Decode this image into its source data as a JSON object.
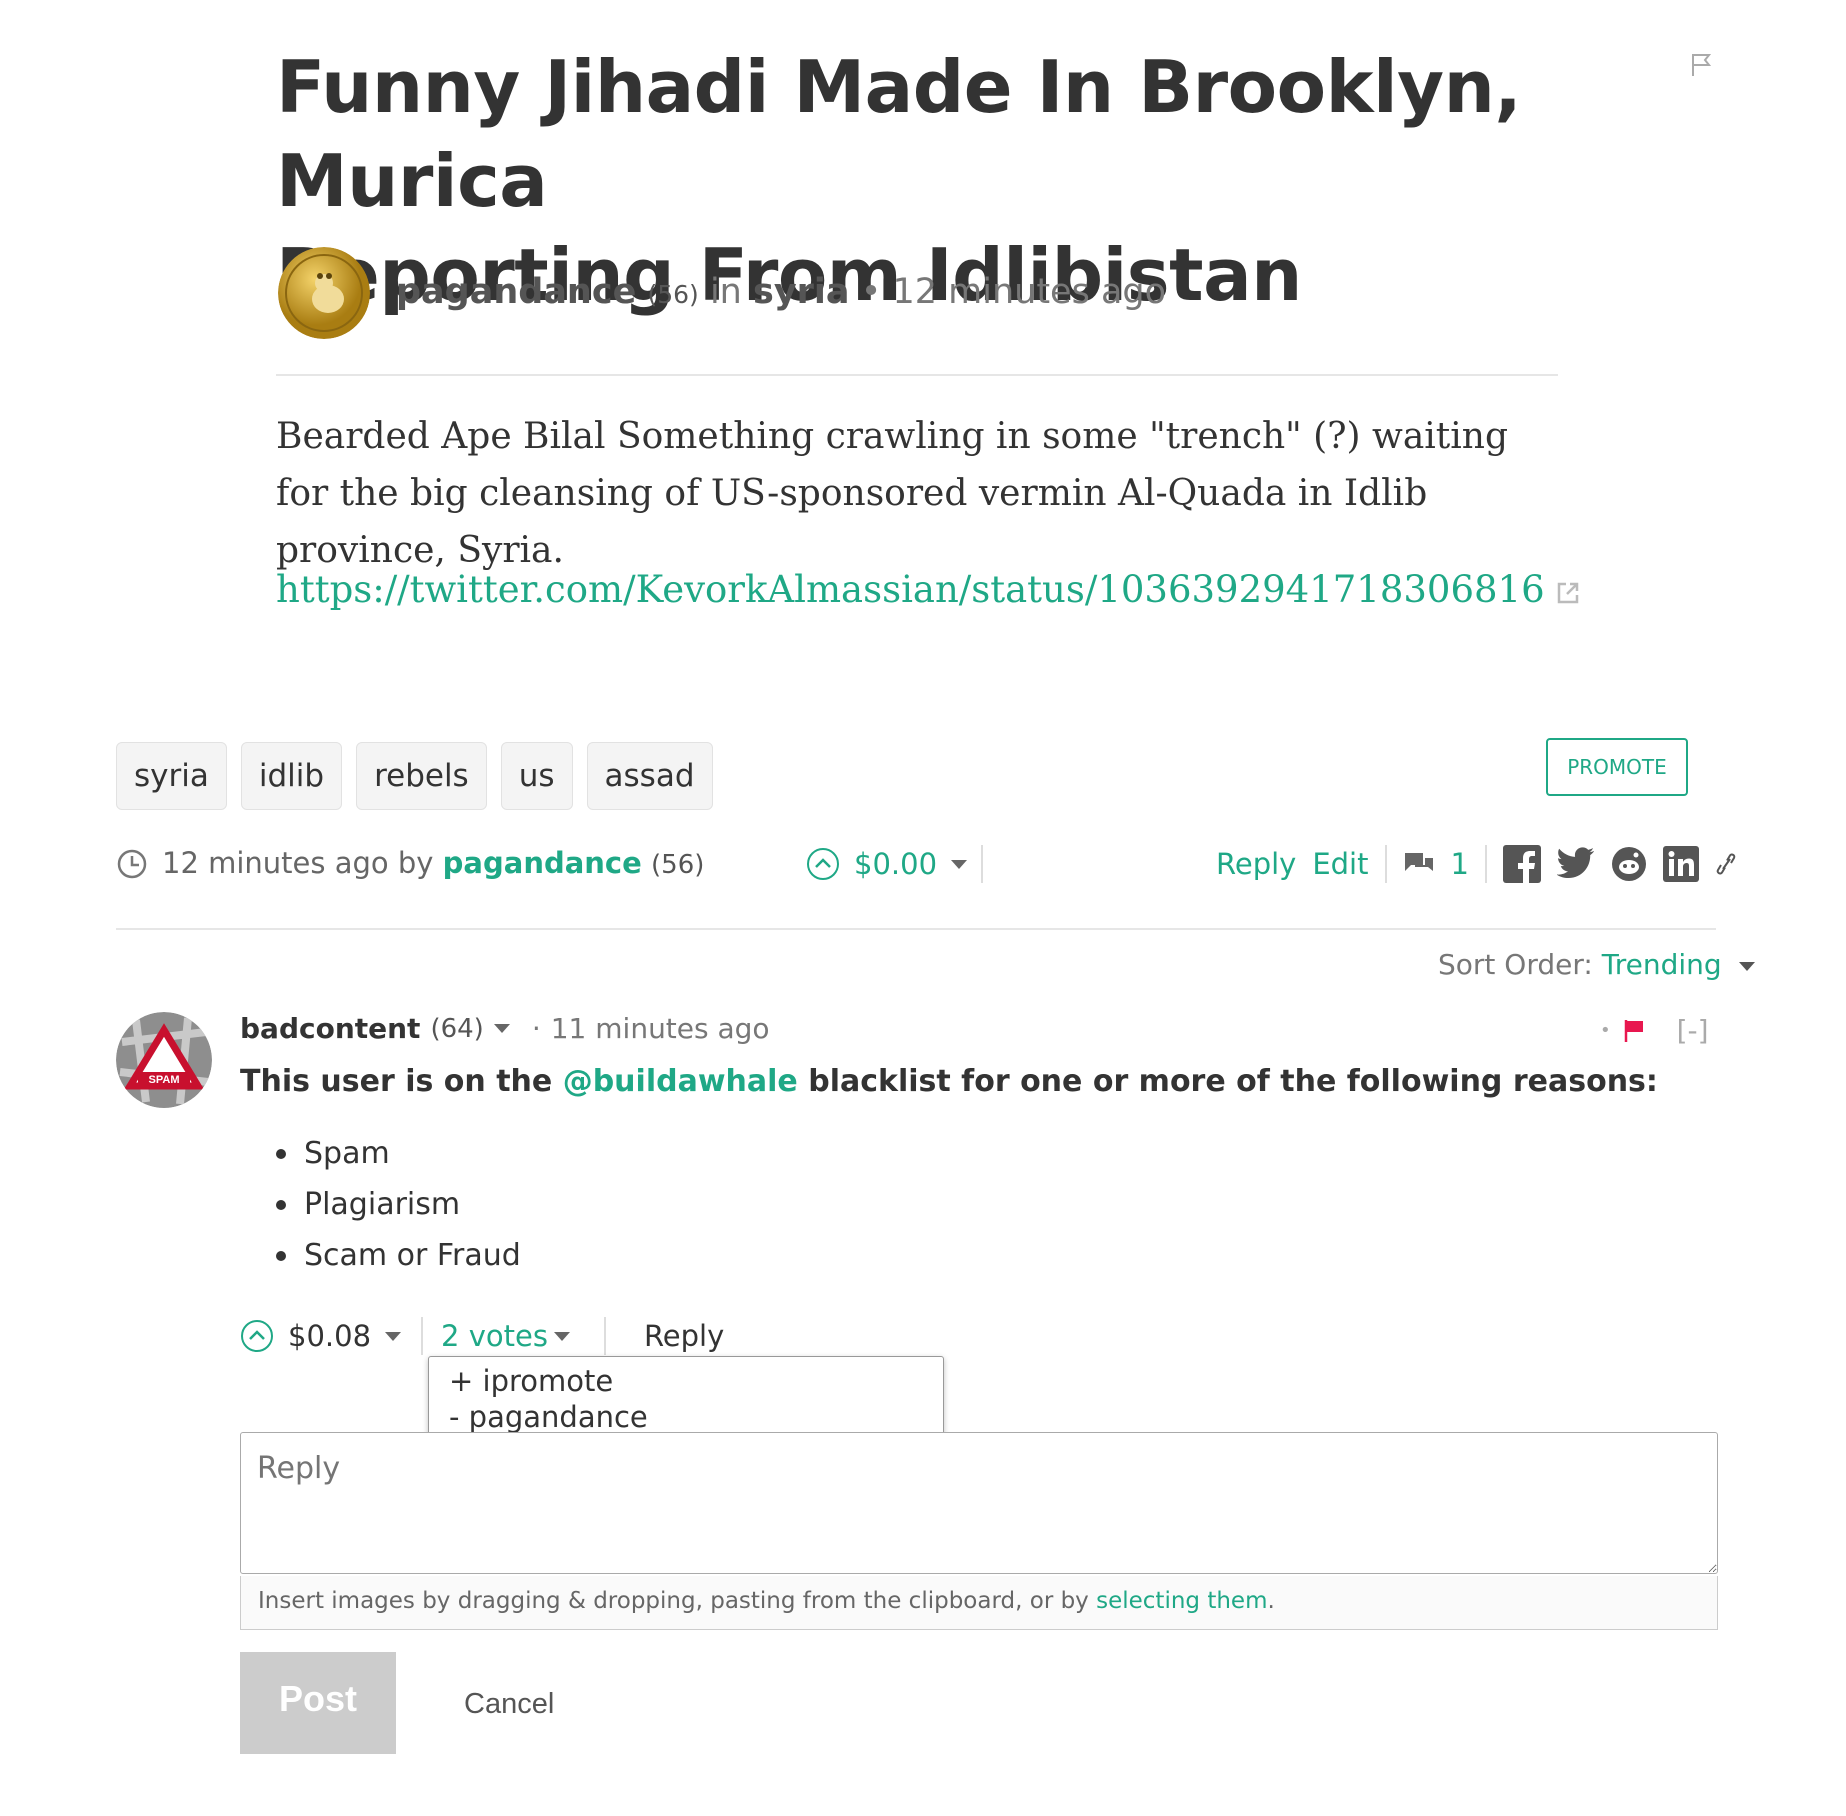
{
  "post": {
    "title_line1": "Funny Jihadi Made In Brooklyn, Murica",
    "title_line2": "Reporting From Idlibistan",
    "author": "pagandance",
    "author_rep": "(56)",
    "in_word": "in",
    "category": "syria",
    "time": "12 minutes ago",
    "body": "Bearded Ape Bilal Something crawling in some \"trench\" (?) waiting for the big cleansing of US-sponsored vermin Al-Quada in Idlib province, Syria.",
    "link": "https://twitter.com/KevorkAlmassian/status/1036392941718306816"
  },
  "tags": [
    "syria",
    "idlib",
    "rebels",
    "us",
    "assad"
  ],
  "promote_label": "PROMOTE",
  "footer": {
    "time_by": "12 minutes ago by",
    "author": "pagandance",
    "author_rep": "(56)",
    "payout": "$0.00",
    "reply": "Reply",
    "edit": "Edit",
    "comment_count": "1"
  },
  "sort": {
    "label": "Sort Order:",
    "value": "Trending"
  },
  "comment": {
    "author": "badcontent",
    "author_rep": "(64)",
    "dot": "·",
    "time": "11 minutes ago",
    "collapse": "[-]",
    "text_before": "This user is on the ",
    "mention": "@buildawhale",
    "text_after": " blacklist for one or more of the following reasons:",
    "reasons": [
      "Spam",
      "Plagiarism",
      "Scam or Fraud"
    ],
    "payout": "$0.08",
    "votes": "2 votes",
    "reply": "Reply",
    "voters": [
      "+ ipromote",
      "- pagandance"
    ]
  },
  "reply_form": {
    "placeholder": "Reply",
    "hint_before": "Insert images by dragging & dropping, pasting from the clipboard, or by ",
    "hint_link": "selecting them",
    "hint_after": ".",
    "post": "Post",
    "cancel": "Cancel"
  },
  "colors": {
    "accent": "#1fa886",
    "flag": "#e8174f"
  }
}
